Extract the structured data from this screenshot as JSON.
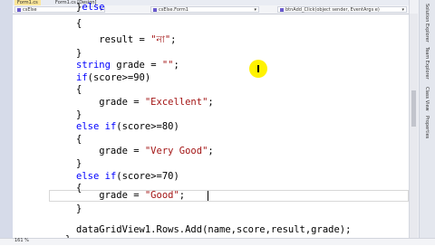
{
  "ide": {
    "tabs": [
      {
        "label": "Form1.cs",
        "active": true
      },
      {
        "label": "Form1.cs [Design]",
        "active": false
      }
    ],
    "nav": {
      "project": "csElse",
      "class": "csElse.Form1",
      "member": "btnAdd_Click(object sender, EventArgs e)"
    },
    "zoom": "161 %",
    "side_tabs": [
      "Solution Explorer",
      "Team Explorer",
      "Class View",
      "Properties"
    ],
    "accent_tab": "#fbe69a",
    "cursor_highlight": "#fff200"
  },
  "code": {
    "lines": [
      [
        {
          "t": "}"
        },
        {
          "t": "else",
          "c": "kw"
        }
      ],
      [
        {
          "t": "{"
        }
      ],
      [
        {
          "t": "    result = "
        },
        {
          "t": "\"না\"",
          "c": "str"
        },
        {
          "t": ";"
        }
      ],
      [
        {
          "t": "}"
        }
      ],
      [
        {
          "t": "string",
          "c": "kw"
        },
        {
          "t": " grade = "
        },
        {
          "t": "\"\"",
          "c": "str"
        },
        {
          "t": ";"
        }
      ],
      [
        {
          "t": "if",
          "c": "kw"
        },
        {
          "t": "(score>=90)"
        }
      ],
      [
        {
          "t": "{"
        }
      ],
      [
        {
          "t": "    grade = "
        },
        {
          "t": "\"Excellent\"",
          "c": "str"
        },
        {
          "t": ";"
        }
      ],
      [
        {
          "t": "}"
        }
      ],
      [
        {
          "t": "else",
          "c": "kw"
        },
        {
          "t": " "
        },
        {
          "t": "if",
          "c": "kw"
        },
        {
          "t": "(score>=80)"
        }
      ],
      [
        {
          "t": "{"
        }
      ],
      [
        {
          "t": "    grade = "
        },
        {
          "t": "\"Very Good\"",
          "c": "str"
        },
        {
          "t": ";"
        }
      ],
      [
        {
          "t": "}"
        }
      ],
      [
        {
          "t": "else",
          "c": "kw"
        },
        {
          "t": " "
        },
        {
          "t": "if",
          "c": "kw"
        },
        {
          "t": "(score>=70)"
        }
      ],
      [
        {
          "t": "{"
        }
      ],
      [
        {
          "t": "    grade = "
        },
        {
          "t": "\"Good\"",
          "c": "str"
        },
        {
          "t": ";"
        }
      ],
      [
        {
          "t": "}"
        }
      ],
      [
        {
          "t": ""
        }
      ],
      [
        {
          "t": "dataGridView1.Rows.Add(name,score,result,grade);"
        }
      ],
      [
        {
          "t": "}"
        }
      ]
    ]
  }
}
